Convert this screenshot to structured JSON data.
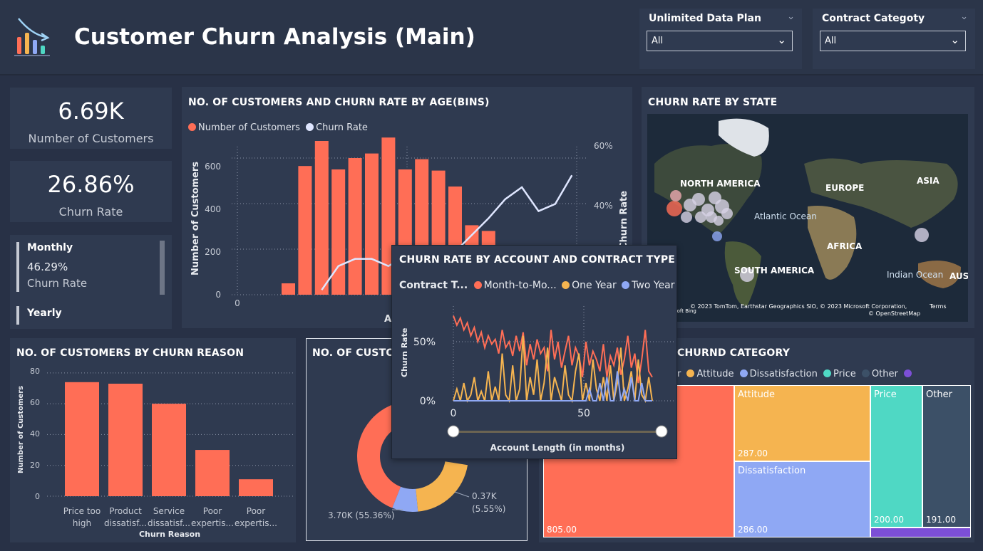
{
  "header": {
    "title": "Customer Churn Analysis (Main)",
    "logo_icon": "bar-chart-trend-down-icon"
  },
  "slicers": [
    {
      "label": "Unlimited Data Plan",
      "value": "All"
    },
    {
      "label": "Contract Categoty",
      "value": "All"
    }
  ],
  "kpis": {
    "customers": {
      "value": "6.69K",
      "label": "Number of Customers"
    },
    "churn": {
      "value": "26.86%",
      "label": "Churn Rate"
    }
  },
  "contract_card": {
    "items": [
      {
        "label": "Monthly",
        "value": "46.29%",
        "sub": "Churn Rate"
      },
      {
        "label": "Yearly"
      }
    ]
  },
  "colors": {
    "orange": "#ff6e56",
    "light": "#dfe6ff",
    "yellow": "#f5b450",
    "blue": "#8fa8f4",
    "teal": "#4fd8c4",
    "slate": "#3c5067",
    "purple": "#7c4fd6"
  },
  "age_chart": {
    "title": "NO. OF CUSTOMERS AND CHURN RATE BY AGE(BINS)",
    "legend": [
      "Number of Customers",
      "Churn Rate"
    ],
    "ylabel": "Number of Customers",
    "y2label": "Churn Rate",
    "xlabel": "A",
    "yticks": [
      "0",
      "200",
      "400",
      "600"
    ],
    "y2ticks": [
      "40%",
      "60%"
    ],
    "xticks": [
      "0"
    ]
  },
  "map": {
    "title": "CHURN RATE BY STATE",
    "labels": [
      "NORTH AMERICA",
      "EUROPE",
      "ASIA",
      "Atlantic Ocean",
      "AFRICA",
      "SOUTH AMERICA",
      "Indian Ocean",
      "AUS"
    ],
    "attribution": "© 2023 TomTom, Earthstar Geographics SIO, © 2023 Microsoft Corporation,",
    "terms": "Terms",
    "osm": "© OpenStreetMap",
    "bing": "soft Bing"
  },
  "reason_chart": {
    "title": "NO. OF CUSTOMERS BY CHURN REASON",
    "ylabel": "Number of Customers",
    "xlabel": "Churn Reason",
    "yticks": [
      "0",
      "20",
      "40",
      "60",
      "80"
    ]
  },
  "donut": {
    "title": "NO. OF CUSTOM",
    "labels": [
      "3.70K (55.36%)",
      "0.37K",
      "(5.55%)"
    ]
  },
  "treemap": {
    "title": "CHURND CATEGORY",
    "legend": [
      "or",
      "Attitude",
      "Dissatisfaction",
      "Price",
      "Other",
      ""
    ],
    "cells": [
      {
        "label": "",
        "value": "805.00"
      },
      {
        "label": "Attitude",
        "value": "287.00"
      },
      {
        "label": "Dissatisfaction",
        "value": "286.00"
      },
      {
        "label": "Price",
        "value": "200.00"
      },
      {
        "label": "Other",
        "value": "191.00"
      }
    ]
  },
  "tooltip": {
    "title": "CHURN RATE BY ACCOUNT AND CONTRACT TYPE",
    "legend_title": "Contract T...",
    "legend": [
      "Month-to-Mo...",
      "One Year",
      "Two Year"
    ],
    "ylabel": "Churn Rate",
    "xlabel": "Account Length (in months)",
    "yticks": [
      "0%",
      "50%"
    ],
    "xticks": [
      "0",
      "50"
    ]
  },
  "chart_data": [
    {
      "type": "bar",
      "title": "NO. OF CUSTOMERS AND CHURN RATE BY AGE(BINS)",
      "ylabel": "Number of Customers",
      "y2label": "Churn Rate",
      "ylim": [
        0,
        650
      ],
      "y2lim": [
        0,
        62
      ],
      "series": [
        {
          "name": "Number of Customers",
          "values": [
            50,
            565,
            675,
            550,
            600,
            620,
            690,
            550,
            595,
            545,
            475,
            305,
            280,
            130
          ]
        },
        {
          "name": "Churn Rate",
          "values": [
            null,
            null,
            2,
            12,
            15,
            15,
            12,
            16,
            15,
            15,
            18,
            25,
            32,
            40,
            45,
            35,
            38,
            50
          ]
        }
      ]
    },
    {
      "type": "bar",
      "title": "NO. OF CUSTOMERS BY CHURN REASON",
      "xlabel": "Churn Reason",
      "ylabel": "Number of Customers",
      "categories": [
        "Price too high",
        "Product dissatisf...",
        "Service dissatisf...",
        "Poor expertis...",
        "Poor expertis..."
      ],
      "values": [
        74,
        73,
        60,
        30,
        11
      ],
      "ylim": [
        0,
        85
      ]
    },
    {
      "type": "pie",
      "values": [
        3.7,
        0.37
      ],
      "labels": [
        "3.70K (55.36%)",
        "0.37K (5.55%)"
      ]
    },
    {
      "type": "heatmap",
      "title": "CHURND CATEGORY",
      "categories": [
        "",
        "Attitude",
        "Dissatisfaction",
        "Price",
        "Other"
      ],
      "values": [
        805,
        287,
        286,
        200,
        191
      ]
    },
    {
      "type": "line",
      "title": "CHURN RATE BY ACCOUNT AND CONTRACT TYPE",
      "xlabel": "Account Length (in months)",
      "ylabel": "Churn Rate",
      "series": [
        {
          "name": "Month-to-Mo...",
          "values": [
            72,
            64,
            70,
            60,
            66,
            55,
            62,
            50,
            58,
            45,
            55,
            48,
            52,
            40,
            60,
            45,
            50,
            38,
            55,
            42,
            58,
            30,
            48,
            35,
            52,
            40,
            45,
            25,
            60,
            35,
            50,
            28,
            42,
            55,
            30,
            45,
            38,
            20,
            50,
            30,
            42,
            35,
            25,
            48,
            20,
            38,
            30,
            45,
            22,
            35,
            55,
            28,
            40,
            15,
            35,
            60,
            25,
            20
          ]
        },
        {
          "name": "One Year",
          "values": [
            0,
            10,
            0,
            15,
            0,
            5,
            20,
            0,
            8,
            0,
            25,
            0,
            12,
            0,
            40,
            5,
            0,
            30,
            0,
            10,
            55,
            0,
            20,
            5,
            35,
            0,
            15,
            45,
            0,
            20,
            10,
            0,
            30,
            5,
            0,
            25,
            40,
            0,
            15,
            0,
            35,
            10,
            0,
            20,
            0,
            30,
            0,
            15,
            45,
            0,
            10,
            25,
            0,
            35,
            5,
            0,
            20,
            0
          ]
        },
        {
          "name": "Two Year",
          "values": [
            0,
            0,
            0,
            0,
            0,
            0,
            0,
            0,
            0,
            0,
            0,
            0,
            0,
            0,
            0,
            0,
            0,
            0,
            0,
            0,
            0,
            0,
            0,
            0,
            0,
            0,
            0,
            0,
            0,
            0,
            0,
            0,
            0,
            0,
            0,
            0,
            0,
            0,
            0,
            10,
            0,
            0,
            15,
            0,
            20,
            0,
            0,
            25,
            0,
            10,
            0,
            20,
            0,
            0,
            15,
            0,
            0,
            0
          ]
        }
      ]
    }
  ]
}
